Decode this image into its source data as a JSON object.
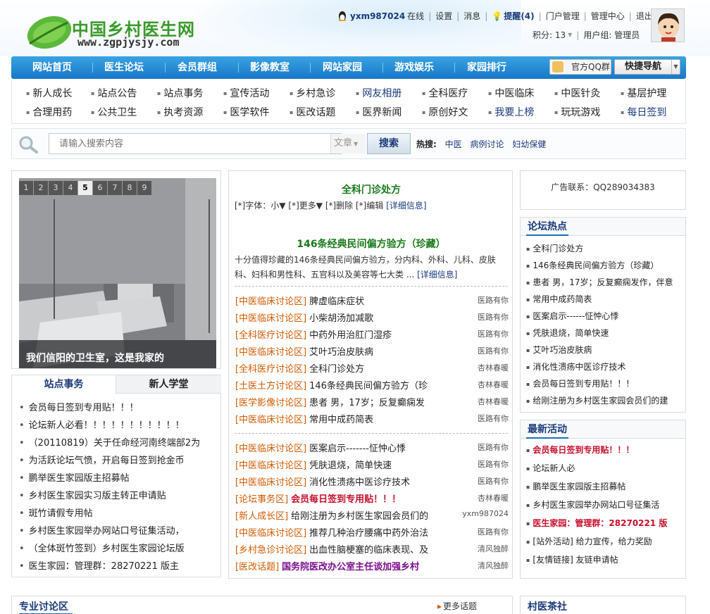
{
  "header": {
    "logo_text": "中国乡村医生网",
    "logo_url": "www.zgpjysjy.com",
    "user": {
      "name": "yxm987024",
      "online": "在线",
      "links": [
        "设置",
        "消息"
      ],
      "remind": "提醒(4)",
      "links2": [
        "门户管理",
        "管理中心",
        "退出"
      ],
      "points": "积分: 13",
      "group": "用户组: 管理员"
    }
  },
  "nav": {
    "items": [
      "网站首页",
      "医生论坛",
      "会员群组",
      "影像教室",
      "网站家园",
      "游戏娱乐",
      "家园排行"
    ],
    "qq_group": "官方QQ群",
    "quick_nav": "快捷导航"
  },
  "categories": {
    "row1": [
      "新人成长",
      "站点公告",
      "站点事务",
      "宣传活动",
      "乡村急诊",
      "网友相册",
      "全科医疗",
      "中医临床",
      "中医针灸",
      "基层护理"
    ],
    "row2": [
      "合理用药",
      "公共卫生",
      "执考资源",
      "医学软件",
      "医改话题",
      "医界新闻",
      "原创好文",
      "我要上榜",
      "玩玩游戏",
      "每日签到"
    ]
  },
  "search": {
    "placeholder": "请输入搜索内容",
    "type": "文章",
    "button": "搜索",
    "hot_label": "热搜:",
    "hot_keywords": [
      "中医",
      "病例讨论",
      "妇幼保健"
    ]
  },
  "slider": {
    "pages": [
      "1",
      "2",
      "3",
      "4",
      "5",
      "6",
      "7",
      "8",
      "9"
    ],
    "active_page": "5",
    "caption": "我们信阳的卫生室，这是我家的"
  },
  "left_tabs": {
    "tabs": [
      "站点事务",
      "新人学堂"
    ],
    "items": [
      "会员每日签到专用贴！！！",
      "论坛新人必看！！！！！！！！！！！",
      "（20110819）关于任命经河南终端部2为",
      "为活跃论坛气愤，开启每日签到抢金币",
      "鹏举医生家园版主招募帖",
      "乡村医生家园实习版主转正申请贴",
      "斑竹请假专用帖",
      "乡村医生家园举办网站口号征集活动，",
      "（全体斑竹签到）乡村医生家园论坛版",
      "医生家园：管理群：28270221 版主"
    ]
  },
  "middle": {
    "feature1": {
      "title": "全科门诊处方",
      "meta": "[*]字体：小▼ [*]更多▼ [*]删除 [*]编辑",
      "detail": "[详细信息]"
    },
    "feature2": {
      "title": "146条经典民间偏方验方（珍藏）",
      "desc_line1": "十分值得珍藏的146条经典民间偏方验方，分内科、外科、儿科、皮肤",
      "desc_line2": "科、妇科和男性科、五官科以及美容等七大类 ...",
      "detail": "[详细信息]"
    },
    "list1": [
      {
        "cat": "[中医临床讨论区]",
        "title": "脾虚临床症状",
        "author": "医路有你"
      },
      {
        "cat": "[中医临床讨论区]",
        "title": "小柴胡汤加减歌",
        "author": "医路有你"
      },
      {
        "cat": "[全科医疗讨论区]",
        "title": "中药外用治肛门湿疹",
        "author": "医路有你"
      },
      {
        "cat": "[中医临床讨论区]",
        "title": "艾叶巧治皮肤病",
        "author": "医路有你"
      },
      {
        "cat": "[全科医疗讨论区]",
        "title": "全科门诊处方",
        "author": "杏林春暖"
      },
      {
        "cat": "[土医土方讨论区]",
        "title": "146条经典民间偏方验方（珍",
        "author": "杏林春暖"
      },
      {
        "cat": "[医学影像讨论区]",
        "title": "患者 男，17岁；反复癫痫发",
        "author": "杏林春暖"
      },
      {
        "cat": "[中医临床讨论区]",
        "title": "常用中成药简表",
        "author": "医路有你"
      }
    ],
    "list2": [
      {
        "cat": "[中医临床讨论区]",
        "title": "医案启示-------怔忡心悸",
        "author": "医路有你",
        "style": ""
      },
      {
        "cat": "[中医临床讨论区]",
        "title": "凭肤退烧，简单快速",
        "author": "医路有你",
        "style": ""
      },
      {
        "cat": "[中医临床讨论区]",
        "title": "消化性溃疡中医诊疗技术",
        "author": "医路有你",
        "style": ""
      },
      {
        "cat": "[论坛事务区]",
        "title": "会员每日签到专用贴！！！",
        "author": "杏林春暖",
        "style": "red"
      },
      {
        "cat": "[新人成长区]",
        "title": "给刚注册为乡村医生家园会员们的",
        "author": "yxm987024",
        "style": ""
      },
      {
        "cat": "[中医临床讨论区]",
        "title": "推荐几种治疗腰痛中药外治法",
        "author": "医路有你",
        "style": ""
      },
      {
        "cat": "[乡村急诊讨论区]",
        "title": "出血性脑梗塞的临床表现、及",
        "author": "清风独醉",
        "style": ""
      },
      {
        "cat": "[医改话题]",
        "title": "国务院医改办公室主任谈加强乡村",
        "author": "清风独醉",
        "style": "purple"
      }
    ]
  },
  "right": {
    "ad": "广告联系：QQ289034383",
    "hot_title": "论坛热点",
    "hot_items": [
      "全科门诊处方",
      "146条经典民间偏方验方（珍藏）",
      "患者 男，17岁；反复癫痫发作，伴意",
      "常用中成药简表",
      "医案启示------怔忡心悸",
      "凭肤退烧，简单快速",
      "艾叶巧治皮肤病",
      "消化性溃疡中医诊疗技术",
      "会员每日签到专用贴！！！",
      "给刚注册为乡村医生家园会员们的建"
    ],
    "activity_title": "最新活动",
    "activity_items": [
      {
        "text": "会员每日签到专用贴！！！",
        "style": "red"
      },
      {
        "text": "论坛新人必",
        "style": ""
      },
      {
        "text": "鹏举医生家园版主招募帖",
        "style": ""
      },
      {
        "text": "乡村医生家园举办网站口号征集活",
        "style": ""
      },
      {
        "text": "医生家园：管理群：28270221 版",
        "style": "red"
      },
      {
        "text": "[站外活动] 给力宣传，给力奖励",
        "style": ""
      },
      {
        "text": "[友情链接] 友链申请帖",
        "style": ""
      }
    ]
  },
  "bottom": {
    "left_title": "专业讨论区",
    "more": "更多话题",
    "right_title": "村医茶社"
  }
}
